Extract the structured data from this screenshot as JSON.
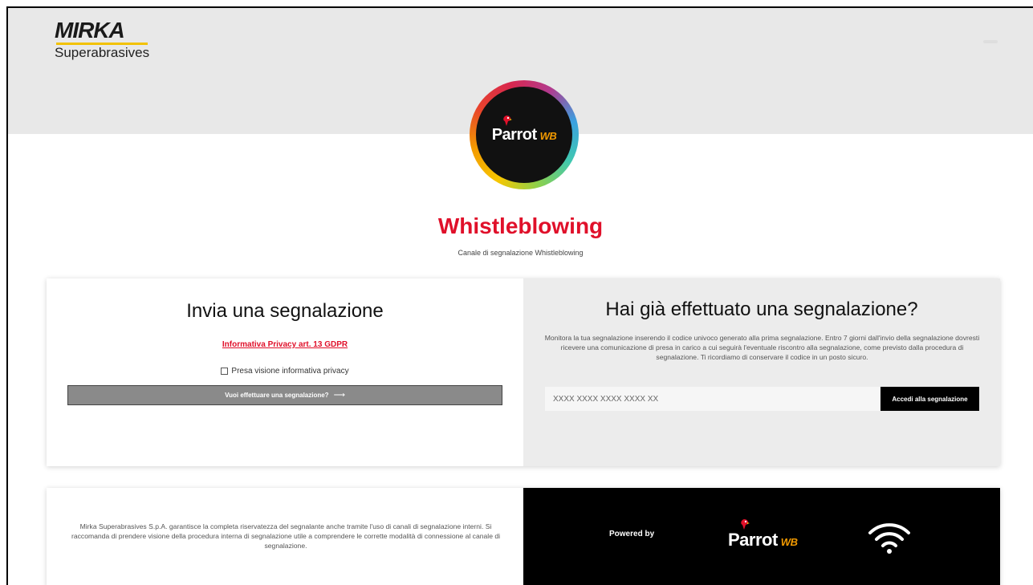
{
  "header": {
    "logo_mark": "MIRKA",
    "logo_sub": "Superabrasives"
  },
  "badge": {
    "word": "Parrot",
    "suffix": "WB"
  },
  "hero": {
    "title": "Whistleblowing",
    "subtitle": "Canale di segnalazione Whistleblowing"
  },
  "send": {
    "heading": "Invia una segnalazione",
    "privacy_link": "Informativa Privacy art. 13 GDPR",
    "consent_label": "Presa visione informativa privacy",
    "button_label": "Vuoi effettuare una segnalazione?",
    "button_arrow": "⟶"
  },
  "track": {
    "heading": "Hai già effettuato una segnalazione?",
    "description": "Monitora la tua segnalazione inserendo il codice univoco generato alla prima segnalazione. Entro 7 giorni dall'invio della segnalazione dovresti ricevere una comunicazione di presa in carico a cui seguirà l'eventuale riscontro alla segnalazione, come previsto dalla procedura di segnalazione. Ti ricordiamo di conservare il codice in un posto sicuro.",
    "code_placeholder": "XXXX XXXX XXXX XXXX XX",
    "button_label": "Accedi alla segnalazione"
  },
  "footer": {
    "text": "Mirka Superabrasives S.p.A. garantisce la completa riservatezza del segnalante anche tramite l'uso di canali di segnalazione interni. Si raccomanda di prendere visione della procedura interna di segnalazione utile a comprendere le corrette modalità di connessione al canale di segnalazione.",
    "powered_by": "Powered by",
    "logo_word": "Parrot",
    "logo_suffix": "WB"
  },
  "colors": {
    "accent_red": "#e0102a",
    "hero_band": "#e8e8e8",
    "button_grey": "#8a8a8a",
    "footer_dark": "#000000",
    "logo_yellow": "#f2c200"
  },
  "icons": {
    "menu": "menu-icon",
    "arrow": "arrow-right-icon",
    "wifi": "wifi-icon",
    "parrot": "parrot-bird-icon"
  }
}
